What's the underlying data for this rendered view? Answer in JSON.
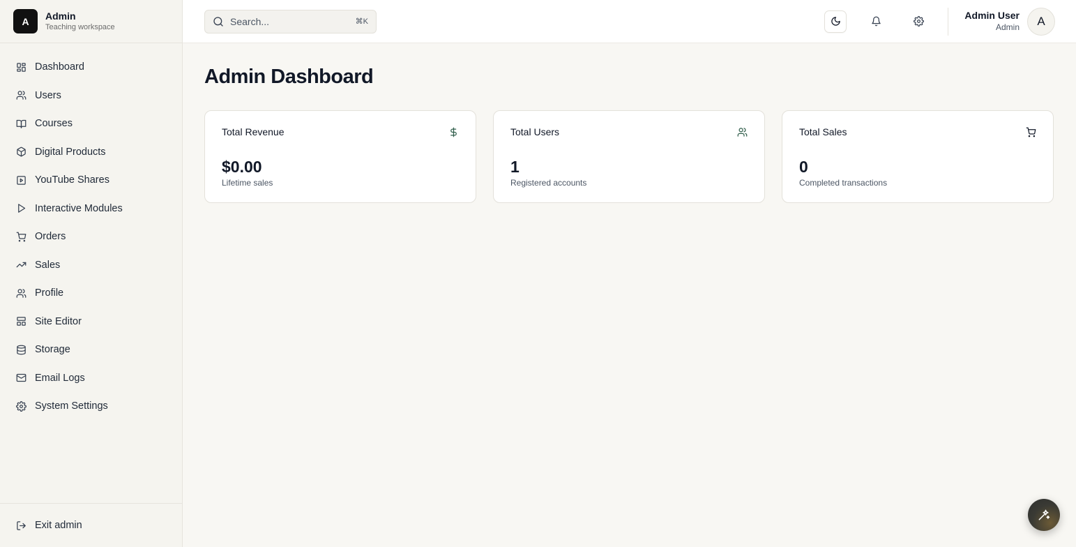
{
  "brand": {
    "logo_letter": "A",
    "title": "Admin",
    "subtitle": "Teaching workspace"
  },
  "sidebar": {
    "items": [
      {
        "label": "Dashboard",
        "icon": "dashboard-grid-icon"
      },
      {
        "label": "Users",
        "icon": "users-icon"
      },
      {
        "label": "Courses",
        "icon": "book-icon"
      },
      {
        "label": "Digital Products",
        "icon": "package-icon"
      },
      {
        "label": "YouTube Shares",
        "icon": "video-icon"
      },
      {
        "label": "Interactive Modules",
        "icon": "play-icon"
      },
      {
        "label": "Orders",
        "icon": "cart-icon"
      },
      {
        "label": "Sales",
        "icon": "trending-up-icon"
      },
      {
        "label": "Profile",
        "icon": "user-icon"
      },
      {
        "label": "Site Editor",
        "icon": "layout-icon"
      },
      {
        "label": "Storage",
        "icon": "database-icon"
      },
      {
        "label": "Email Logs",
        "icon": "mail-icon"
      },
      {
        "label": "System Settings",
        "icon": "gear-icon"
      }
    ],
    "footer": {
      "label": "Exit admin",
      "icon": "logout-icon"
    }
  },
  "header": {
    "search": {
      "placeholder": "Search...",
      "shortcut": "⌘K"
    },
    "user": {
      "name": "Admin User",
      "role": "Admin",
      "avatar_letter": "A"
    }
  },
  "main": {
    "title": "Admin Dashboard",
    "cards": [
      {
        "title": "Total Revenue",
        "value": "$0.00",
        "subtitle": "Lifetime sales",
        "icon": "dollar-icon"
      },
      {
        "title": "Total Users",
        "value": "1",
        "subtitle": "Registered accounts",
        "icon": "users-icon"
      },
      {
        "title": "Total Sales",
        "value": "0",
        "subtitle": "Completed transactions",
        "icon": "cart-icon"
      }
    ]
  },
  "colors": {
    "accent_icon": "#2f5d4a",
    "logo_bg": "#111111",
    "background": "#f8f7f3"
  }
}
